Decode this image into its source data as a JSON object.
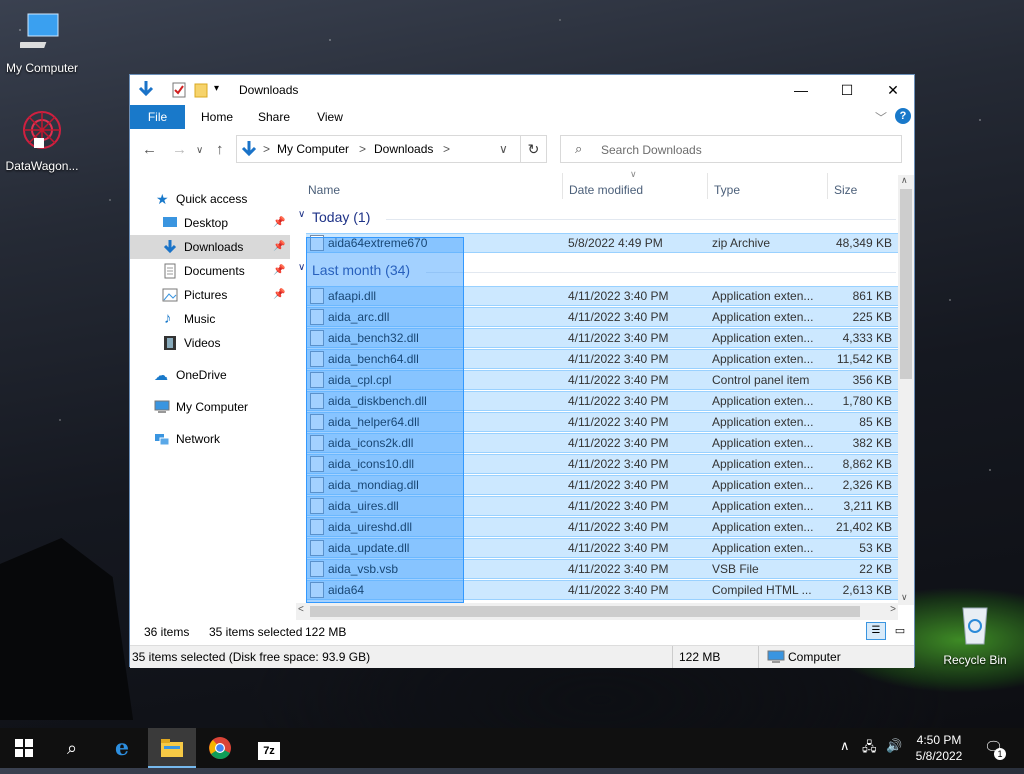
{
  "desktop": {
    "icons": [
      {
        "label": "My Computer"
      },
      {
        "label": "DataWagon..."
      },
      {
        "label": "Recycle Bin"
      }
    ]
  },
  "window": {
    "title": "Downloads",
    "ribbon_tabs": [
      "File",
      "Home",
      "Share",
      "View"
    ],
    "address": {
      "root": "My Computer",
      "current": "Downloads",
      "sep": ">"
    },
    "search_placeholder": "Search Downloads",
    "nav": {
      "quick_access": "Quick access",
      "items": [
        {
          "label": "Desktop",
          "pinned": true
        },
        {
          "label": "Downloads",
          "pinned": true,
          "selected": true
        },
        {
          "label": "Documents",
          "pinned": true
        },
        {
          "label": "Pictures",
          "pinned": true
        },
        {
          "label": "Music"
        },
        {
          "label": "Videos"
        }
      ],
      "onedrive": "OneDrive",
      "my_computer": "My Computer",
      "network": "Network"
    },
    "columns": [
      "Name",
      "Date modified",
      "Type",
      "Size"
    ],
    "groups": [
      {
        "label": "Today (1)"
      },
      {
        "label": "Last month (34)"
      }
    ],
    "today_files": [
      {
        "name": "aida64extreme670",
        "date": "5/8/2022 4:49 PM",
        "type": "zip Archive",
        "size": "48,349 KB"
      }
    ],
    "month_files": [
      {
        "name": "afaapi.dll",
        "date": "4/11/2022 3:40 PM",
        "type": "Application exten...",
        "size": "861 KB"
      },
      {
        "name": "aida_arc.dll",
        "date": "4/11/2022 3:40 PM",
        "type": "Application exten...",
        "size": "225 KB"
      },
      {
        "name": "aida_bench32.dll",
        "date": "4/11/2022 3:40 PM",
        "type": "Application exten...",
        "size": "4,333 KB"
      },
      {
        "name": "aida_bench64.dll",
        "date": "4/11/2022 3:40 PM",
        "type": "Application exten...",
        "size": "11,542 KB"
      },
      {
        "name": "aida_cpl.cpl",
        "date": "4/11/2022 3:40 PM",
        "type": "Control panel item",
        "size": "356 KB"
      },
      {
        "name": "aida_diskbench.dll",
        "date": "4/11/2022 3:40 PM",
        "type": "Application exten...",
        "size": "1,780 KB"
      },
      {
        "name": "aida_helper64.dll",
        "date": "4/11/2022 3:40 PM",
        "type": "Application exten...",
        "size": "85 KB"
      },
      {
        "name": "aida_icons2k.dll",
        "date": "4/11/2022 3:40 PM",
        "type": "Application exten...",
        "size": "382 KB"
      },
      {
        "name": "aida_icons10.dll",
        "date": "4/11/2022 3:40 PM",
        "type": "Application exten...",
        "size": "8,862 KB"
      },
      {
        "name": "aida_mondiag.dll",
        "date": "4/11/2022 3:40 PM",
        "type": "Application exten...",
        "size": "2,326 KB"
      },
      {
        "name": "aida_uires.dll",
        "date": "4/11/2022 3:40 PM",
        "type": "Application exten...",
        "size": "3,211 KB"
      },
      {
        "name": "aida_uireshd.dll",
        "date": "4/11/2022 3:40 PM",
        "type": "Application exten...",
        "size": "21,402 KB"
      },
      {
        "name": "aida_update.dll",
        "date": "4/11/2022 3:40 PM",
        "type": "Application exten...",
        "size": "53 KB"
      },
      {
        "name": "aida_vsb.vsb",
        "date": "4/11/2022 3:40 PM",
        "type": "VSB File",
        "size": "22 KB"
      },
      {
        "name": "aida64",
        "date": "4/11/2022 3:40 PM",
        "type": "Compiled HTML ...",
        "size": "2,613 KB"
      }
    ],
    "status": {
      "items": "36 items",
      "selected": "35 items selected",
      "size": "122 MB"
    },
    "details": {
      "left": "35 items selected (Disk free space: 93.9 GB)",
      "size": "122 MB",
      "location": "Computer"
    }
  },
  "taskbar": {
    "clock_time": "4:50 PM",
    "clock_date": "5/8/2022",
    "notification_count": "1",
    "apps": [
      "7z"
    ]
  },
  "colors": {
    "accent": "#1979ca",
    "selection": "#cce8ff",
    "group_header": "#1e3287"
  }
}
